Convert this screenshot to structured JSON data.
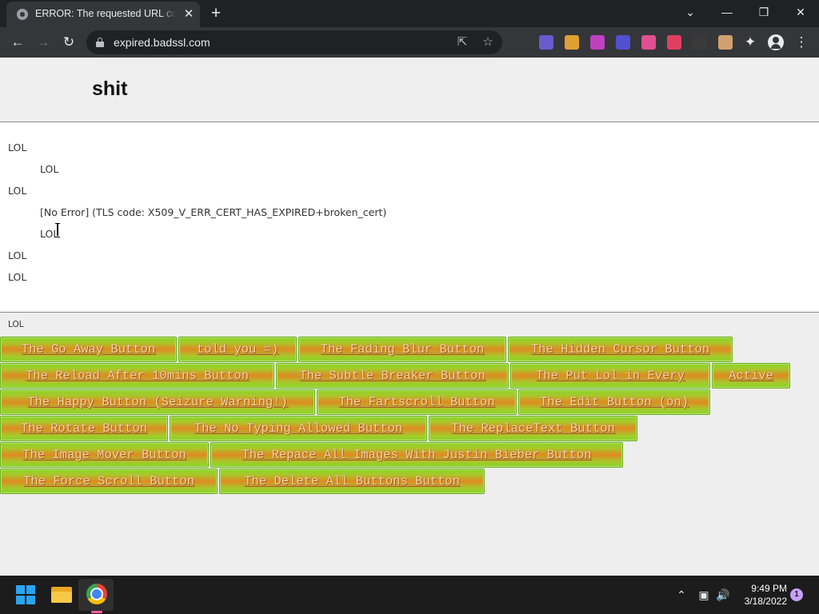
{
  "browser": {
    "tab_title": "ERROR: The requested URL could not be retrieved",
    "url": "expired.badssl.com",
    "icons": {
      "favicon": "globe-icon",
      "back": "arrow-left-icon",
      "forward": "arrow-right-icon",
      "reload": "reload-icon",
      "share": "share-icon",
      "bookmark": "star-icon",
      "extensions": "puzzle-icon",
      "menu": "kebab-menu-icon"
    },
    "extension_colors": [
      "#6a5acd",
      "#e0a030",
      "#c040c0",
      "#5050d0",
      "#e05090",
      "#e04060",
      "#3a3a3a",
      "#d0a070"
    ]
  },
  "page": {
    "title": "shit",
    "lines": [
      "LOL",
      "LOL",
      "LOL",
      "[No Error] (TLS code: X509_V_ERR_CERT_HAS_EXPIRED+broken_cert)",
      "LOL",
      "LOL",
      "LOL"
    ],
    "footer_label": "LOL",
    "buttons": [
      [
        "The Go Away Button",
        "told you =)",
        "The Fading Blur Button",
        "The Hidden Cursor Button"
      ],
      [
        "The Reload After 10mins Button",
        "The Subtle Breaker Button",
        "The Put Lol in Every",
        "Active"
      ],
      [
        "The Happy Button (Seizure Warning!)",
        "The Fartscroll Button",
        "The Edit Button (on)"
      ],
      [
        "The Rotate Button",
        "The No Typing Allowed Button",
        "The ReplaceText Button"
      ],
      [
        "The Image Mover Button",
        "The Repace All Images With Justin Bieber Button"
      ],
      [
        "The Force Scroll Button",
        "The Delete All Buttons Button"
      ]
    ]
  },
  "taskbar": {
    "time": "9:49 PM",
    "date": "3/18/2022",
    "notification_count": "1",
    "icons": [
      "windows-start-icon",
      "file-explorer-icon",
      "chrome-icon"
    ]
  }
}
